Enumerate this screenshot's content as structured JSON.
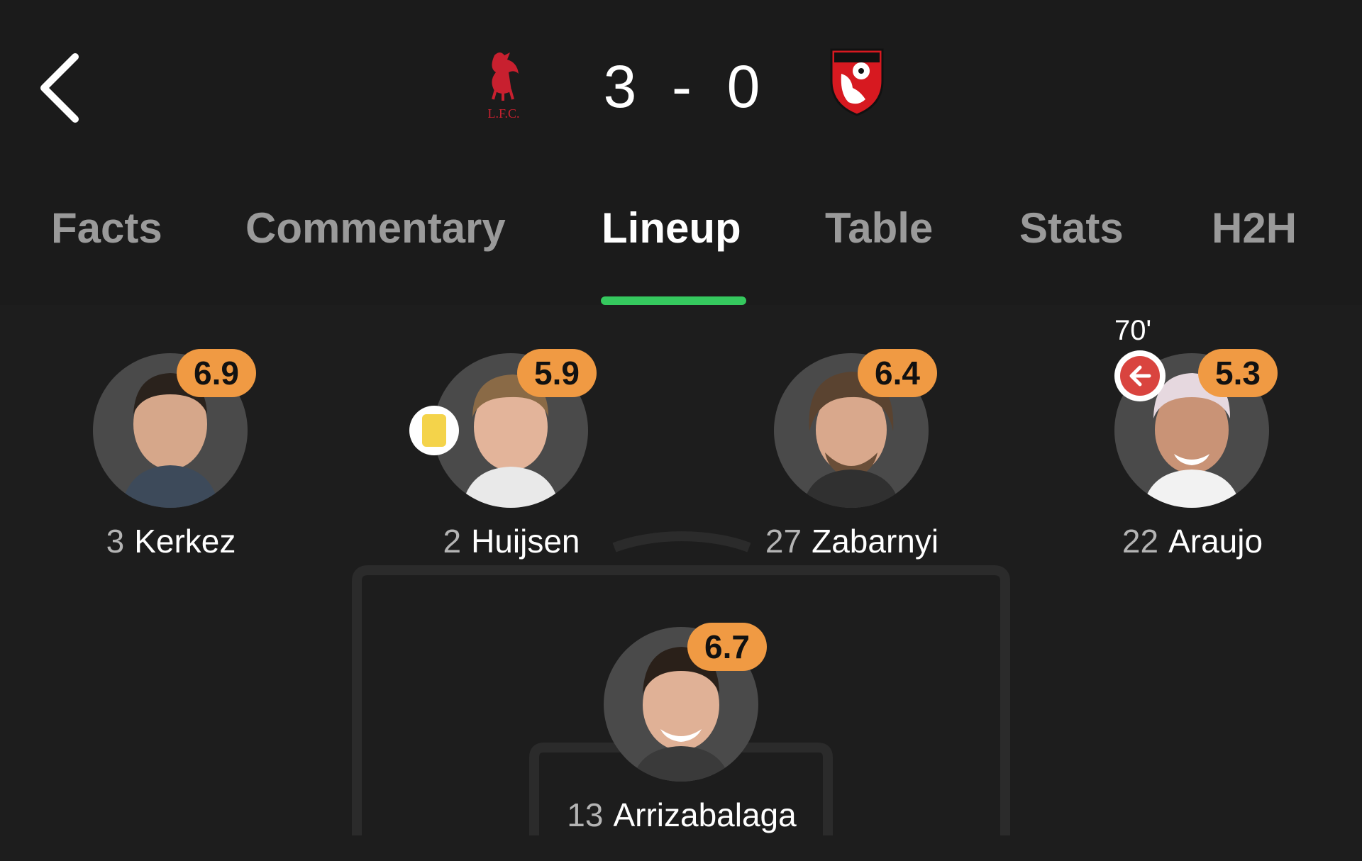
{
  "nav": {
    "back_icon": "chevron-left-icon"
  },
  "match": {
    "home_crest": "liverpool-crest",
    "home_crest_text": "L.F.C.",
    "home_score": "3",
    "separator": "-",
    "away_score": "0",
    "away_crest": "bournemouth-crest"
  },
  "tabs": [
    {
      "label": "Facts",
      "active": false
    },
    {
      "label": "Commentary",
      "active": false
    },
    {
      "label": "Lineup",
      "active": true
    },
    {
      "label": "Table",
      "active": false
    },
    {
      "label": "Stats",
      "active": false
    },
    {
      "label": "H2H",
      "active": false
    }
  ],
  "colors": {
    "accent": "#35c85e",
    "rating": "#f09a43",
    "background": "#1d1d1d",
    "yellow_card": "#f4d34a",
    "sub_out": "#d9443f"
  },
  "players": [
    {
      "number": "3",
      "name": "Kerkez",
      "rating": "6.9"
    },
    {
      "number": "2",
      "name": "Huijsen",
      "rating": "5.9",
      "yellow_card": true
    },
    {
      "number": "27",
      "name": "Zabarnyi",
      "rating": "6.4"
    },
    {
      "number": "22",
      "name": "Araujo",
      "rating": "5.3",
      "sub_minute": "70'"
    },
    {
      "number": "13",
      "name": "Arrizabalaga",
      "rating": "6.7"
    }
  ]
}
